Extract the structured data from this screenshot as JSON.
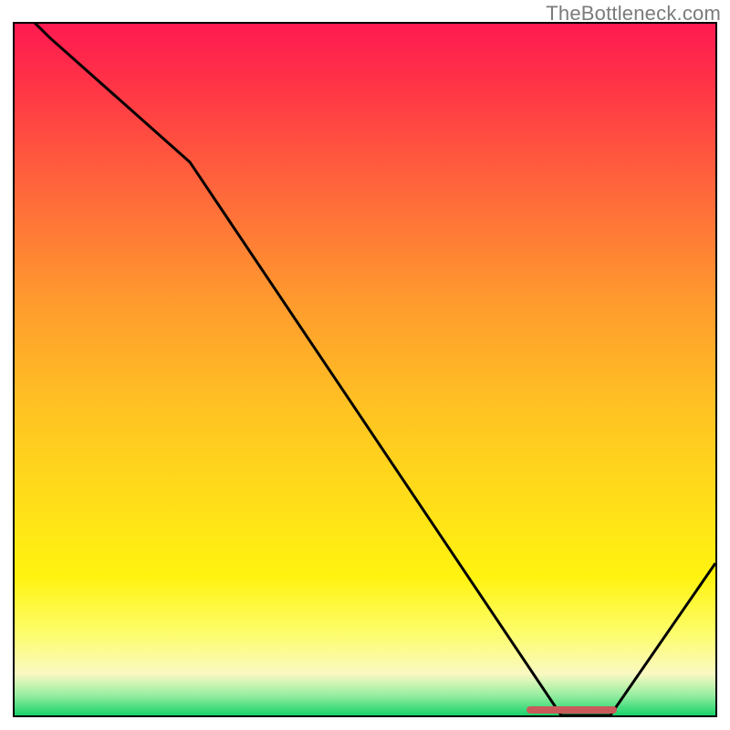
{
  "watermark": "TheBottleneck.com",
  "colors": {
    "gradient_top": "#ff1a52",
    "gradient_bottom": "#18d36a",
    "curve": "#000000",
    "marker": "#c85a5a",
    "border": "#000000"
  },
  "chart_data": {
    "type": "line",
    "title": "",
    "xlabel": "",
    "ylabel": "",
    "xlim": [
      0,
      100
    ],
    "ylim": [
      0,
      100
    ],
    "grid": false,
    "x": [
      0,
      5,
      25,
      78,
      85,
      100
    ],
    "values": [
      103,
      98,
      80,
      0,
      0,
      22
    ],
    "marker": {
      "x_start": 73,
      "x_end": 86,
      "y": 0
    },
    "notes": "Single black curve over red→green vertical gradient; curve minimum plateau near x≈78–85 at y≈0."
  }
}
